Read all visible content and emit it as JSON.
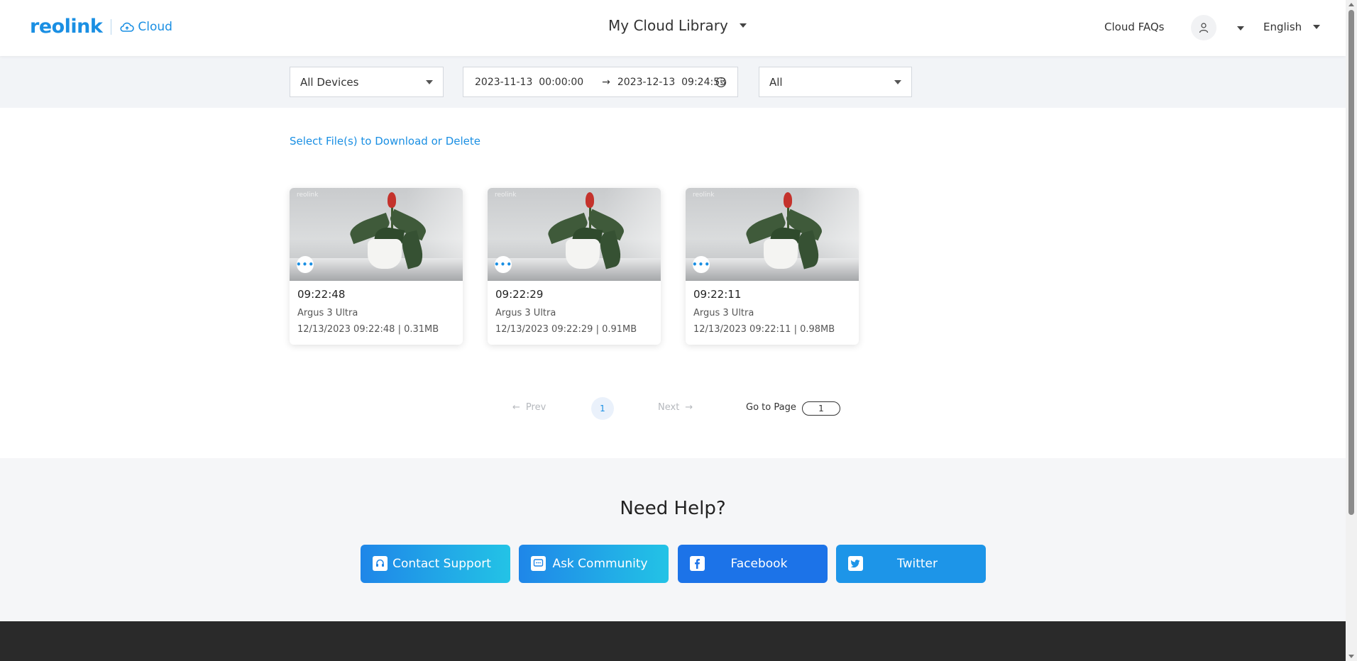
{
  "header": {
    "logo_text": "reolink",
    "logo_cloud": "Cloud",
    "title": "My Cloud Library",
    "faq": "Cloud FAQs",
    "language": "English"
  },
  "filters": {
    "device": "All Devices",
    "date_start": "2023-11-13  00:00:00",
    "date_end": "2023-12-13  09:24:53",
    "type": "All"
  },
  "select_link": "Select File(s) to Download or Delete",
  "cards": [
    {
      "time": "09:22:48",
      "device": "Argus 3 Ultra",
      "meta": "12/13/2023 09:22:48 | 0.31MB",
      "more": "•••",
      "watermark": "reolink"
    },
    {
      "time": "09:22:29",
      "device": "Argus 3 Ultra",
      "meta": "12/13/2023 09:22:29 | 0.91MB",
      "more": "•••",
      "watermark": "reolink"
    },
    {
      "time": "09:22:11",
      "device": "Argus 3 Ultra",
      "meta": "12/13/2023 09:22:11 | 0.98MB",
      "more": "•••",
      "watermark": "reolink"
    }
  ],
  "pager": {
    "prev": "Prev",
    "current": "1",
    "next": "Next",
    "goto_label": "Go to Page",
    "goto_value": "1"
  },
  "help": {
    "title": "Need Help?",
    "buttons": [
      {
        "label": "Contact Support",
        "icon": "headset-icon"
      },
      {
        "label": "Ask Community",
        "icon": "chat-icon"
      },
      {
        "label": "Facebook",
        "icon": "facebook-icon"
      },
      {
        "label": "Twitter",
        "icon": "twitter-icon"
      }
    ]
  },
  "colors": {
    "brand": "#1a8fe3",
    "footer": "#2a2a2a",
    "filter_bg": "#f2f4f7"
  }
}
